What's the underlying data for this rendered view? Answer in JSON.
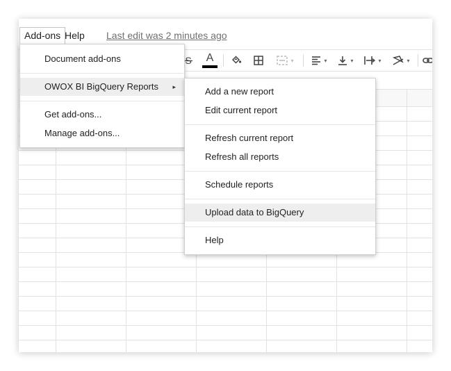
{
  "menubar": {
    "addons": "Add-ons",
    "help": "Help",
    "last_edit": "Last edit was 2 minutes ago"
  },
  "toolbar": {
    "text_color_letter": "A",
    "icons": [
      "strikethrough-icon",
      "text-color-icon",
      "fill-color-icon",
      "borders-icon",
      "merge-cells-icon",
      "align-left-icon",
      "vertical-align-icon",
      "text-wrap-icon",
      "text-rotation-icon",
      "link-icon"
    ],
    "text_color": "#000000"
  },
  "addons_menu": {
    "items": [
      {
        "label": "Document add-ons"
      },
      {
        "label": "OWOX BI BigQuery Reports",
        "has_submenu": true
      },
      {
        "label": "Get add-ons..."
      },
      {
        "label": "Manage add-ons..."
      }
    ],
    "submenu_arrow": "▸"
  },
  "owox_menu": {
    "items": [
      {
        "label": "Add a new report"
      },
      {
        "label": "Edit current report"
      },
      {
        "label": "Refresh current report"
      },
      {
        "label": "Refresh all reports"
      },
      {
        "label": "Schedule reports"
      },
      {
        "label": "Upload data to BigQuery",
        "highlighted": true
      },
      {
        "label": "Help"
      }
    ]
  },
  "colors": {
    "highlight": "#eeeeee",
    "grid_line": "#e2e2e2",
    "menu_text": "#222222",
    "muted_text": "#6f6f6f"
  }
}
